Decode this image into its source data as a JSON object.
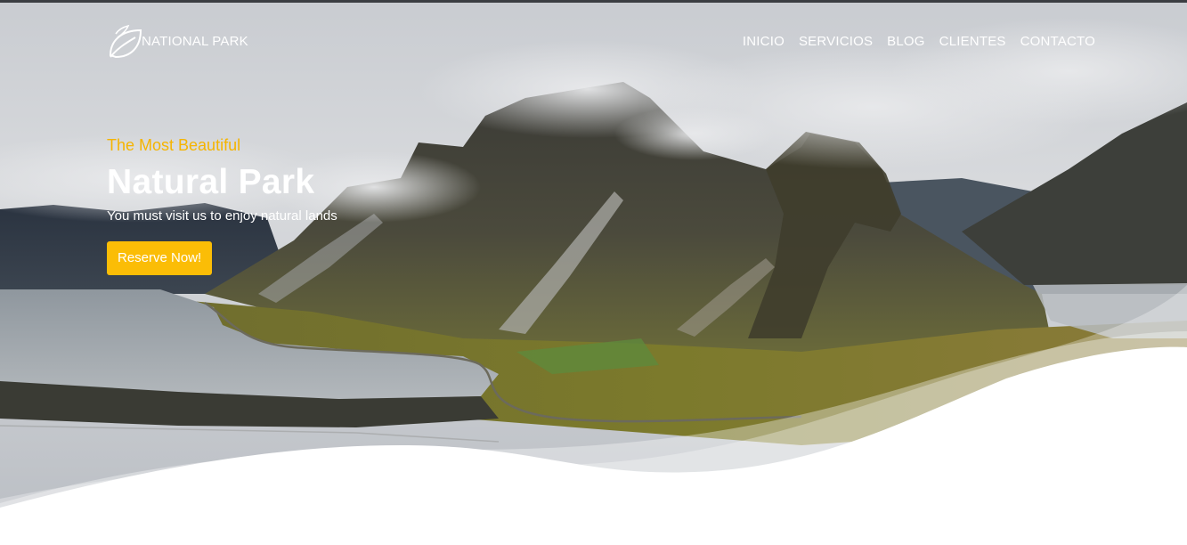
{
  "brand": {
    "name": "NATIONAL PARK",
    "icon": "leaf-icon"
  },
  "nav": {
    "items": [
      {
        "label": "INICIO"
      },
      {
        "label": "SERVICIOS"
      },
      {
        "label": "BLOG"
      },
      {
        "label": "CLIENTES"
      },
      {
        "label": "CONTACTO"
      }
    ]
  },
  "hero": {
    "kicker": "The Most Beautiful",
    "title": "Natural Park",
    "subtitle": "You must visit us to enjoy natural lands",
    "cta_label": "Reserve Now!"
  },
  "colors": {
    "accent": "#fbbd06",
    "kicker": "#f5b400",
    "text": "#ffffff"
  }
}
